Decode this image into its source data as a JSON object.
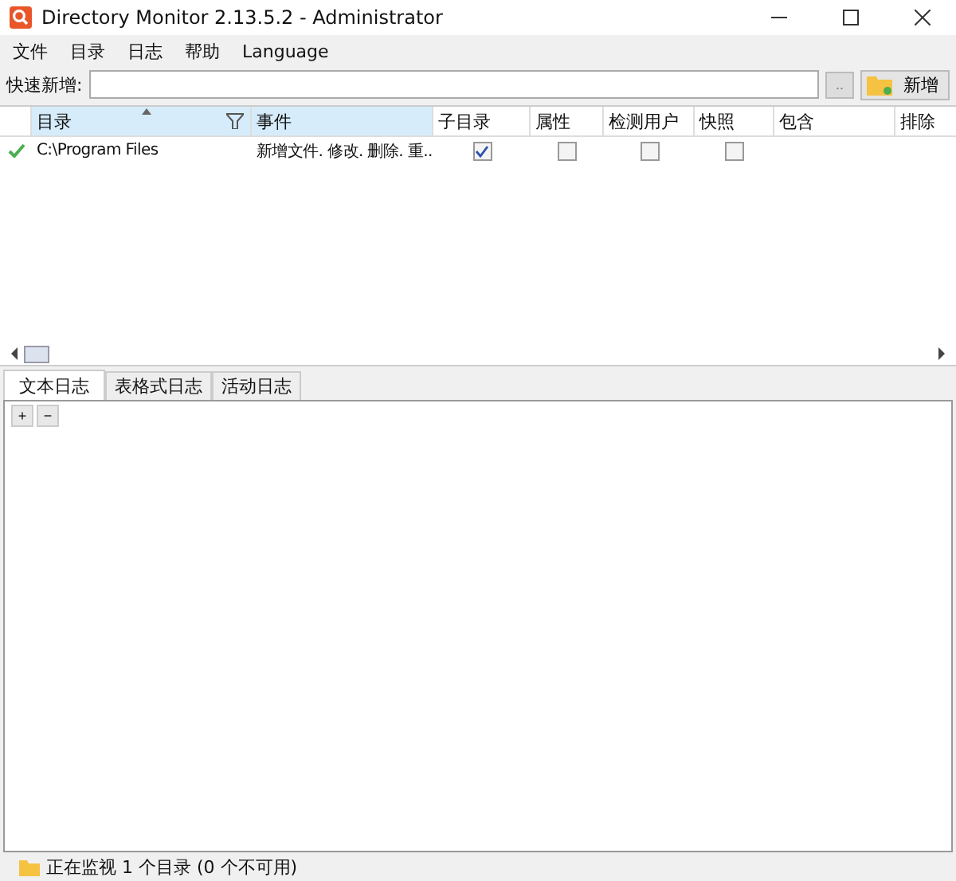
{
  "window": {
    "title": "Directory Monitor 2.13.5.2 - Administrator"
  },
  "menu": [
    "文件",
    "目录",
    "日志",
    "帮助",
    "Language"
  ],
  "quick_add": {
    "label": "快速新增:",
    "browse": "..",
    "add_button": "新增"
  },
  "table": {
    "columns": [
      {
        "label": "目录",
        "selected": true,
        "sorted": true,
        "filter": true
      },
      {
        "label": "事件",
        "selected": true,
        "sorted": false,
        "filter": false
      },
      {
        "label": "子目录",
        "selected": false,
        "sorted": false,
        "filter": false
      },
      {
        "label": "属性",
        "selected": false,
        "sorted": false,
        "filter": false
      },
      {
        "label": "检测用户",
        "selected": false,
        "sorted": false,
        "filter": false
      },
      {
        "label": "快照",
        "selected": false,
        "sorted": false,
        "filter": false
      },
      {
        "label": "包含",
        "selected": false,
        "sorted": false,
        "filter": false
      },
      {
        "label": "排除",
        "selected": false,
        "sorted": false,
        "filter": false
      }
    ],
    "rows": [
      {
        "active": true,
        "directory": "C:\\Program Files",
        "events": "新增文件. 修改. 删除. 重..",
        "subdirs": true,
        "attributes": false,
        "detect_user": false,
        "snapshot": false
      }
    ]
  },
  "log_tabs": [
    {
      "label": "文本日志",
      "selected": true
    },
    {
      "label": "表格式日志",
      "selected": false
    },
    {
      "label": "活动日志",
      "selected": false
    }
  ],
  "log_buttons": [
    "+",
    "−"
  ],
  "status_bar": "正在监视 1 个目录 (0 个不可用)"
}
